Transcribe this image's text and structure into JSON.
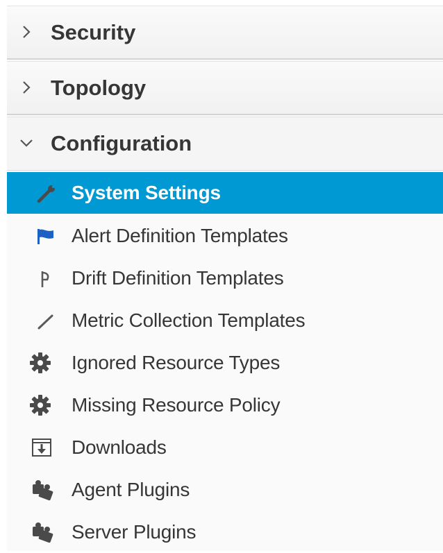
{
  "sections": [
    {
      "label": "Security",
      "expanded": false,
      "chevron": "chevron-right-icon"
    },
    {
      "label": "Topology",
      "expanded": false,
      "chevron": "chevron-right-icon"
    },
    {
      "label": "Configuration",
      "expanded": true,
      "chevron": "chevron-down-icon"
    }
  ],
  "configuration_items": [
    {
      "label": "System Settings",
      "icon": "wrench-icon",
      "selected": true
    },
    {
      "label": "Alert Definition Templates",
      "icon": "flag-icon",
      "selected": false
    },
    {
      "label": "Drift Definition Templates",
      "icon": "drift-icon",
      "selected": false
    },
    {
      "label": "Metric Collection Templates",
      "icon": "pencil-icon",
      "selected": false
    },
    {
      "label": "Ignored Resource Types",
      "icon": "gear-icon",
      "selected": false
    },
    {
      "label": "Missing Resource Policy",
      "icon": "gear-icon",
      "selected": false
    },
    {
      "label": "Downloads",
      "icon": "download-icon",
      "selected": false
    },
    {
      "label": "Agent Plugins",
      "icon": "puzzle-icon",
      "selected": false
    },
    {
      "label": "Server Plugins",
      "icon": "puzzle-icon",
      "selected": false
    }
  ],
  "colors": {
    "selected_background": "#0099d3",
    "text": "#363636",
    "flag_icon": "#1c62c4"
  }
}
